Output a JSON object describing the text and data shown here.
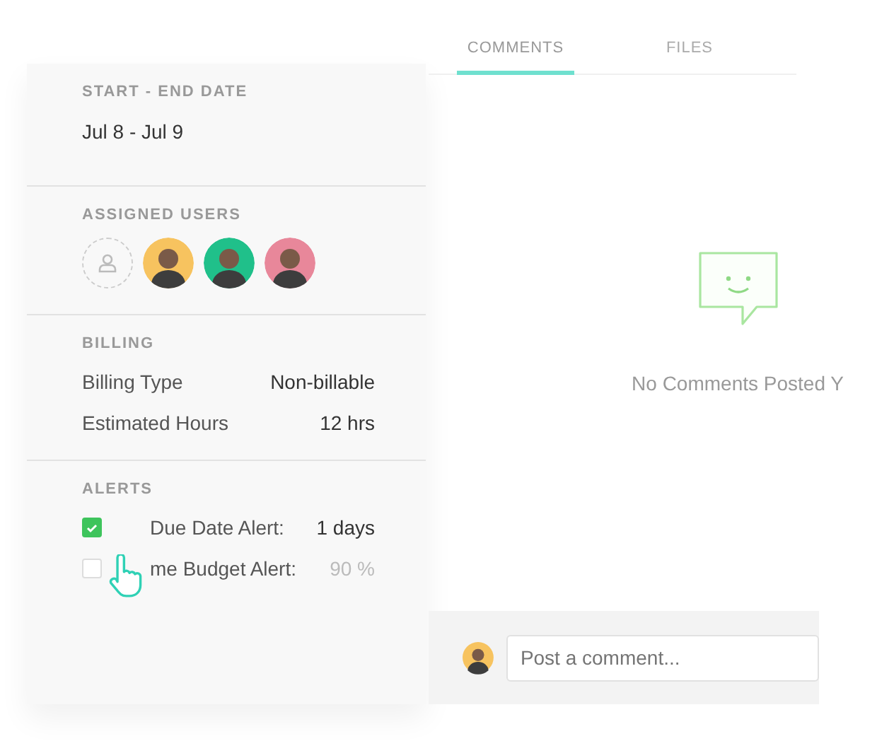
{
  "tabs": [
    {
      "label": "COMMENTS",
      "selected": true
    },
    {
      "label": "FILES",
      "selected": false
    }
  ],
  "date_section": {
    "title": "START - END DATE",
    "value": "Jul 8 - Jul 9"
  },
  "users_section": {
    "title": "ASSIGNED USERS",
    "avatars": [
      {
        "kind": "add"
      },
      {
        "kind": "user",
        "color": "#f7c35f"
      },
      {
        "kind": "user",
        "color": "#20c08a"
      },
      {
        "kind": "user",
        "color": "#e8879a"
      }
    ]
  },
  "billing_section": {
    "title": "BILLING",
    "rows": [
      {
        "label": "Billing Type",
        "value": "Non-billable"
      },
      {
        "label": "Estimated Hours",
        "value": "12 hrs"
      }
    ]
  },
  "alerts_section": {
    "title": "ALERTS",
    "rows": [
      {
        "label": "Due Date Alert:",
        "value": "1 days",
        "checked": true
      },
      {
        "label": "me Budget Alert:",
        "value": "90 %",
        "checked": false
      }
    ]
  },
  "empty_state": {
    "message": "No Comments Posted Y"
  },
  "comment_box": {
    "placeholder": "Post a comment..."
  }
}
